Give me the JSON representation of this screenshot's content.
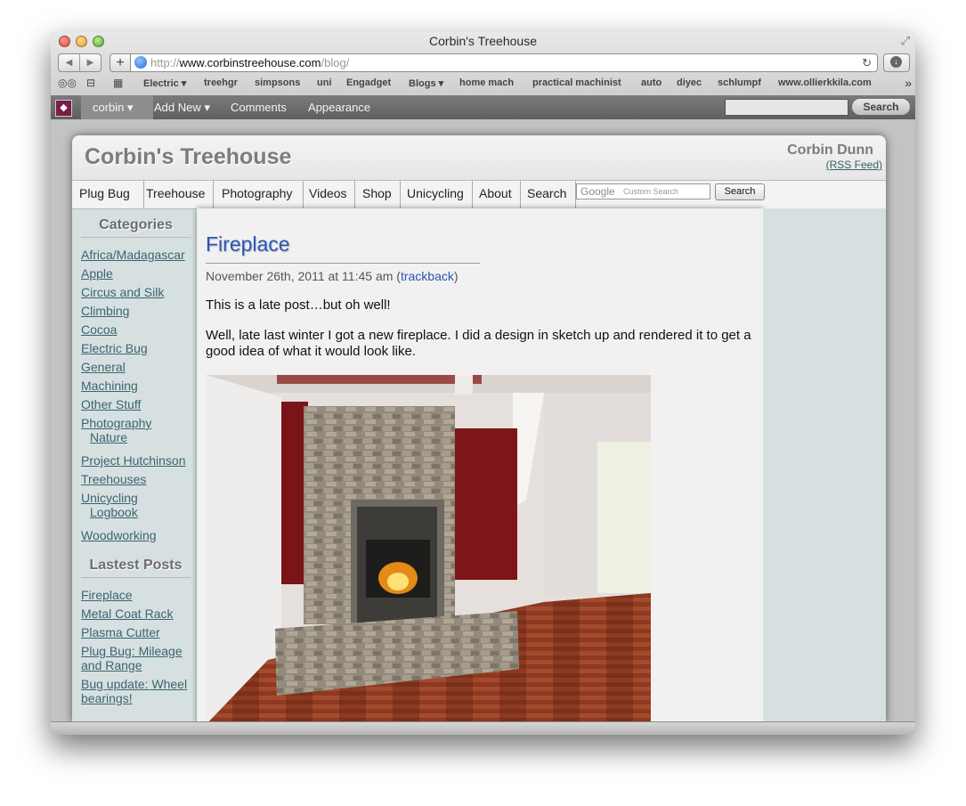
{
  "window": {
    "title": "Corbin's Treehouse"
  },
  "toolbar": {
    "back": "◀",
    "forward": "▶",
    "add": "+",
    "url_scheme": "http://",
    "url_host": "www.corbinstreehouse.com",
    "url_path": "/blog/",
    "reload": "↻",
    "download": "↓"
  },
  "bookmarks": {
    "items": [
      "Electric ▾",
      "treehgr",
      "simpsons",
      "uni",
      "Engadget",
      "Blogs ▾",
      "home mach",
      "practical machinist",
      "auto",
      "diyec",
      "schlumpf",
      "www.ollierkkila.com"
    ],
    "more": "»"
  },
  "adminbar": {
    "user": "corbin ▾",
    "add_new": "Add New ▾",
    "comments": "Comments",
    "appearance": "Appearance",
    "search_label": "Search"
  },
  "site": {
    "title": "Corbin's Treehouse",
    "author": "Corbin Dunn",
    "rss": "(RSS Feed)"
  },
  "nav": {
    "items": [
      "Plug Bug",
      "Treehouse",
      "Photography",
      "Videos",
      "Shop",
      "Unicycling",
      "About",
      "Search"
    ],
    "search_logo": "Google",
    "search_placeholder": "Custom Search",
    "search_button": "Search"
  },
  "sidebar": {
    "categories_heading": "Categories",
    "categories": [
      "Africa/Madagascar",
      "Apple",
      "Circus and Silk",
      "Climbing",
      "Cocoa",
      "Electric Bug",
      "General",
      "Machining",
      "Other Stuff",
      "Photography",
      "Nature",
      "Project Hutchinson",
      "Treehouses",
      "Unicycling",
      "Logbook",
      "Woodworking"
    ],
    "latest_heading": "Lastest Posts",
    "latest": [
      "Fireplace",
      "Metal Coat Rack",
      "Plasma Cutter",
      "Plug Bug: Mileage",
      "and Range",
      "Bug update: Wheel",
      "bearings!"
    ]
  },
  "post": {
    "title": "Fireplace",
    "date": "November 26th, 2011 at 11:45 am (",
    "trackback": "trackback",
    "date_close": ")",
    "p1": "This is a late post…but oh well!",
    "p2": "Well, late last winter I got a new fireplace. I did a design in sketch up and rendered it to get a good idea of what it would look like."
  }
}
